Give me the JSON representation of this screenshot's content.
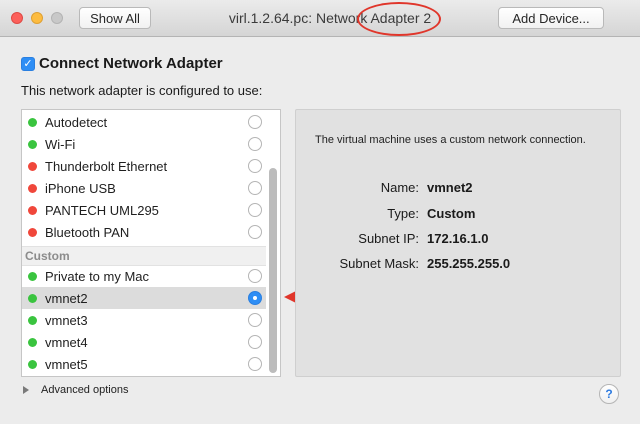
{
  "window": {
    "title": "virl.1.2.64.pc: Network Adapter 2",
    "show_all_label": "Show All",
    "add_device_label": "Add Device..."
  },
  "connect": {
    "checkbox_label": "Connect Network Adapter",
    "checked": true,
    "subtitle": "This network adapter is configured to use:"
  },
  "adapters": {
    "items": [
      {
        "label": "Autodetect",
        "status": "green",
        "selected": false
      },
      {
        "label": "Wi-Fi",
        "status": "green",
        "selected": false
      },
      {
        "label": "Thunderbolt Ethernet",
        "status": "red",
        "selected": false
      },
      {
        "label": "iPhone USB",
        "status": "red",
        "selected": false
      },
      {
        "label": "PANTECH UML295",
        "status": "red",
        "selected": false
      },
      {
        "label": "Bluetooth PAN",
        "status": "red",
        "selected": false
      }
    ],
    "section_header": "Custom",
    "custom_items": [
      {
        "label": "Private to my Mac",
        "status": "green",
        "selected": false
      },
      {
        "label": "vmnet2",
        "status": "green",
        "selected": true
      },
      {
        "label": "vmnet3",
        "status": "green",
        "selected": false
      },
      {
        "label": "vmnet4",
        "status": "green",
        "selected": false
      },
      {
        "label": "vmnet5",
        "status": "green",
        "selected": false
      }
    ]
  },
  "info": {
    "description": "The virtual machine uses a custom network connection.",
    "name_key": "Name:",
    "name_val": "vmnet2",
    "type_key": "Type:",
    "type_val": "Custom",
    "subnet_ip_key": "Subnet IP:",
    "subnet_ip_val": "172.16.1.0",
    "subnet_mask_key": "Subnet Mask:",
    "subnet_mask_val": "255.255.255.0"
  },
  "footer": {
    "advanced_label": "Advanced options",
    "help_label": "?"
  },
  "colors": {
    "accent": "#2e8ef5",
    "status_green": "#3ac43f",
    "status_red": "#f0473b",
    "annotation_red": "#e0362b"
  }
}
